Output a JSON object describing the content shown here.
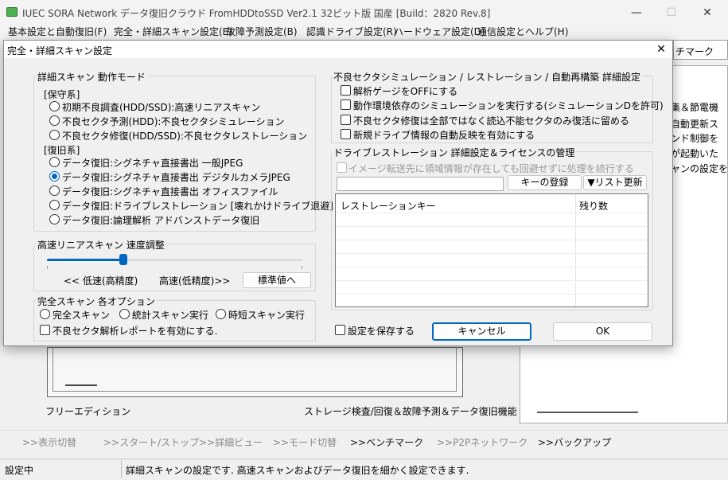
{
  "app": {
    "title": "IUEC SORA Network データ復旧クラウド FromHDDtoSSD Ver2.1 32ビット版 国産 [Build：2820 Rev.8]",
    "window_controls": {
      "minimize": "—",
      "maximize": "☐",
      "close": "✕"
    }
  },
  "menu": [
    "基本設定と自動復旧(F)",
    "完全・詳細スキャン設定(E)",
    "故障予測設定(B)",
    "認識ドライブ設定(R)",
    "ハードウェア設定(D)",
    "通信設定とヘルプ(H)"
  ],
  "background": {
    "tab_fragment": "チマーク",
    "right_lines": [
      "集＆節電機",
      "自動更新ス",
      "ンド制御を",
      "が起動いた",
      "ャンの設定を"
    ],
    "edition": "フリーエディション",
    "function_label": "ストレージ検査/回復＆故障予測＆データ復旧機能"
  },
  "nav": [
    {
      "label": ">>表示切替",
      "active": false
    },
    {
      "label": ">>スタート/ストップ",
      "active": false
    },
    {
      "label": ">>詳細ビュー",
      "active": false
    },
    {
      "label": ">>モード切替",
      "active": false
    },
    {
      "label": ">>ベンチマーク",
      "active": true
    },
    {
      "label": ">>P2Pネットワーク",
      "active": false
    },
    {
      "label": ">>バックアップ",
      "active": true
    }
  ],
  "status": {
    "left": "設定中",
    "message": "詳細スキャンの設定です. 高速スキャンおよびデータ復旧を細かく設定できます."
  },
  "dialog": {
    "title": "完全・詳細スキャン設定",
    "close": "✕",
    "mode_group": {
      "title": "詳細スキャン 動作モード",
      "maintenance_heading": "[保守系]",
      "maintenance_options": [
        "初期不良調査(HDD/SSD):高速リニアスキャン",
        "不良セクタ予測(HDD):不良セクタシミュレーション",
        "不良セクタ修復(HDD/SSD):不良セクタレストレーション"
      ],
      "recovery_heading": "[復旧系]",
      "recovery_options": [
        "データ復旧:シグネチャ直接書出 一般JPEG",
        "データ復旧:シグネチャ直接書出 デジタルカメラJPEG",
        "データ復旧:シグネチャ直接書出 オフィスファイル",
        "データ復旧:ドライブレストレーション [壊れかけドライブ退避]",
        "データ復旧:論理解析 アドバンストデータ復旧"
      ],
      "selected": "データ復旧:シグネチャ直接書出 デジタルカメラJPEG"
    },
    "speed_group": {
      "title": "高速リニアスキャン 速度調整",
      "slow_label": "<< 低速(高精度)",
      "fast_label": "高速(低精度)>>",
      "default_button": "標準値へ",
      "position": 0.3
    },
    "full_scan_group": {
      "title": "完全スキャン 各オプション",
      "options": [
        "完全スキャン",
        "統計スキャン実行",
        "時短スキャン実行"
      ],
      "report_checkbox": "不良セクタ解析レポートを有効にする."
    },
    "sim_group": {
      "title": "不良セクタシミュレーション / レストレーション / 自動再構築 詳細設定",
      "checkboxes": [
        "解析ゲージをOFFにする",
        "動作環境依存のシミュレーションを実行する(シミュレーションDを許可)",
        "不良セクタ修復は全部ではなく読込不能セクタのみ復活に留める",
        "新規ドライブ情報の自動反映を有効にする"
      ]
    },
    "license_group": {
      "title": "ドライブレストレーション 詳細設定＆ライセンスの管理",
      "disabled_checkbox": "イメージ転送先に領域情報が存在しても回避せずに処理を続行する",
      "key_input_value": "",
      "register_button": "キーの登録",
      "refresh_button": "▼リスト更新",
      "columns": [
        "レストレーションキー",
        "残り数"
      ]
    },
    "save_checkbox": "設定を保存する",
    "cancel_button": "キャンセル",
    "ok_button": "OK"
  }
}
